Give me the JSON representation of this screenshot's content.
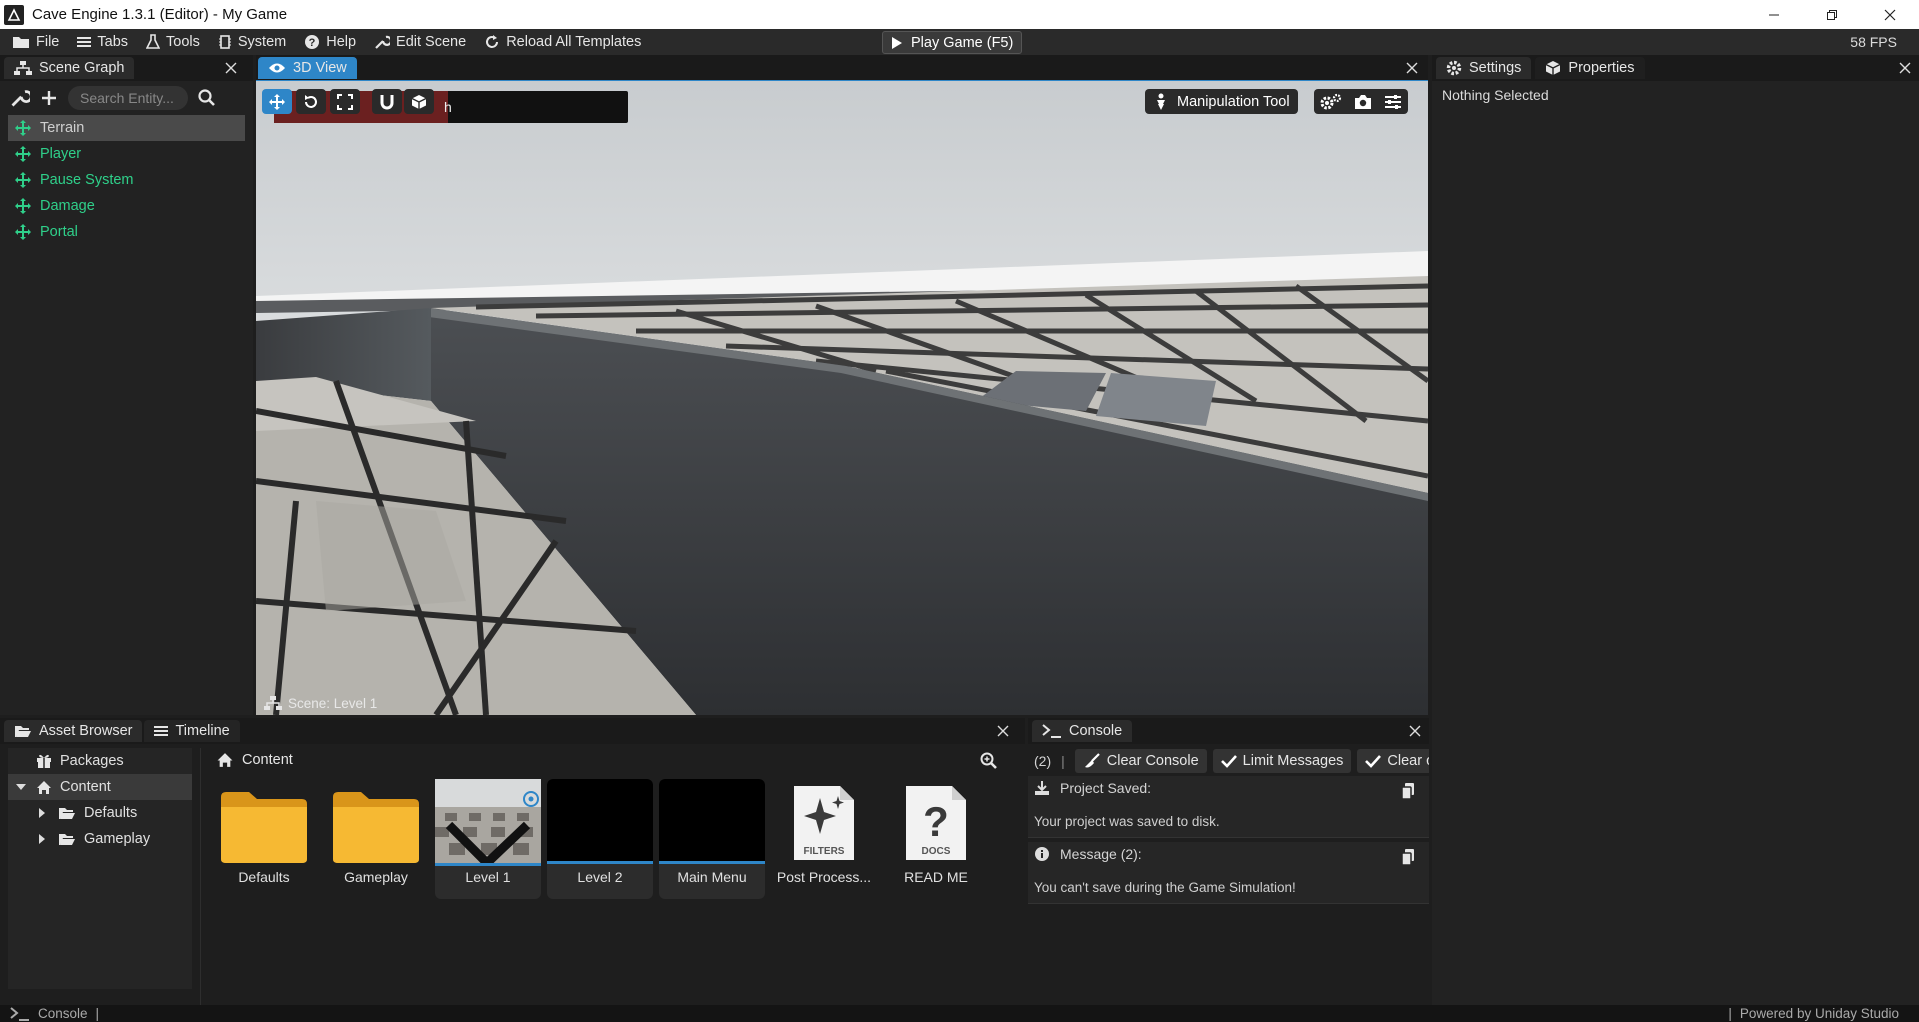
{
  "window": {
    "title": "Cave Engine 1.3.1 (Editor) - My Game"
  },
  "menu": {
    "items": [
      {
        "label": "File",
        "icon": "folder-icon"
      },
      {
        "label": "Tabs",
        "icon": "menu-icon"
      },
      {
        "label": "Tools",
        "icon": "flask-icon"
      },
      {
        "label": "System",
        "icon": "chip-icon"
      },
      {
        "label": "Help",
        "icon": "help-icon"
      },
      {
        "label": "Edit Scene",
        "icon": "wrench-icon"
      },
      {
        "label": "Reload All Templates",
        "icon": "reload-icon"
      }
    ],
    "play_label": "Play Game (F5)",
    "fps": "58 FPS"
  },
  "scene_graph": {
    "tab_label": "Scene Graph",
    "search_placeholder": "Search Entity...",
    "items": [
      {
        "label": "Terrain",
        "selected": true
      },
      {
        "label": "Player",
        "selected": false
      },
      {
        "label": "Pause System",
        "selected": false
      },
      {
        "label": "Damage",
        "selected": false
      },
      {
        "label": "Portal",
        "selected": false
      }
    ]
  },
  "viewport": {
    "tab_label": "3D View",
    "manipulation_label": "Manipulation Tool",
    "scene_label": "Scene: Level 1",
    "overlay_text": "h"
  },
  "inspector": {
    "tabs": [
      "Settings",
      "Properties"
    ],
    "status": "Nothing Selected"
  },
  "asset_browser": {
    "tabs": [
      "Asset Browser",
      "Timeline"
    ],
    "tree": [
      {
        "label": "Packages",
        "icon": "gift-icon"
      },
      {
        "label": "Content",
        "icon": "home-icon"
      },
      {
        "label": "Defaults",
        "icon": "folder-icon"
      },
      {
        "label": "Gameplay",
        "icon": "folder-icon"
      }
    ],
    "breadcrumb": "Content",
    "assets": [
      {
        "label": "Defaults",
        "kind": "folder"
      },
      {
        "label": "Gameplay",
        "kind": "folder"
      },
      {
        "label": "Level 1",
        "kind": "scene"
      },
      {
        "label": "Level 2",
        "kind": "scene"
      },
      {
        "label": "Main Menu",
        "kind": "scene"
      },
      {
        "label": "Post Process...",
        "kind": "doc",
        "badge": "FILTERS"
      },
      {
        "label": "READ ME",
        "kind": "doc",
        "badge": "DOCS"
      }
    ]
  },
  "console": {
    "tab_label": "Console",
    "count": "(2)",
    "separator": "|",
    "buttons": [
      "Clear Console",
      "Limit Messages",
      "Clear on"
    ],
    "messages": [
      {
        "title": "Project Saved:",
        "text": "Your project was saved to disk."
      },
      {
        "title": "Message (2):",
        "text": "You can't save during the Game Simulation!"
      }
    ]
  },
  "statusbar": {
    "left": "Console",
    "sep": "|",
    "right": "Powered by Uniday Studio"
  },
  "colors": {
    "accent": "#2e86c8",
    "entity": "#2fd08a",
    "folder": "#f5b731"
  }
}
